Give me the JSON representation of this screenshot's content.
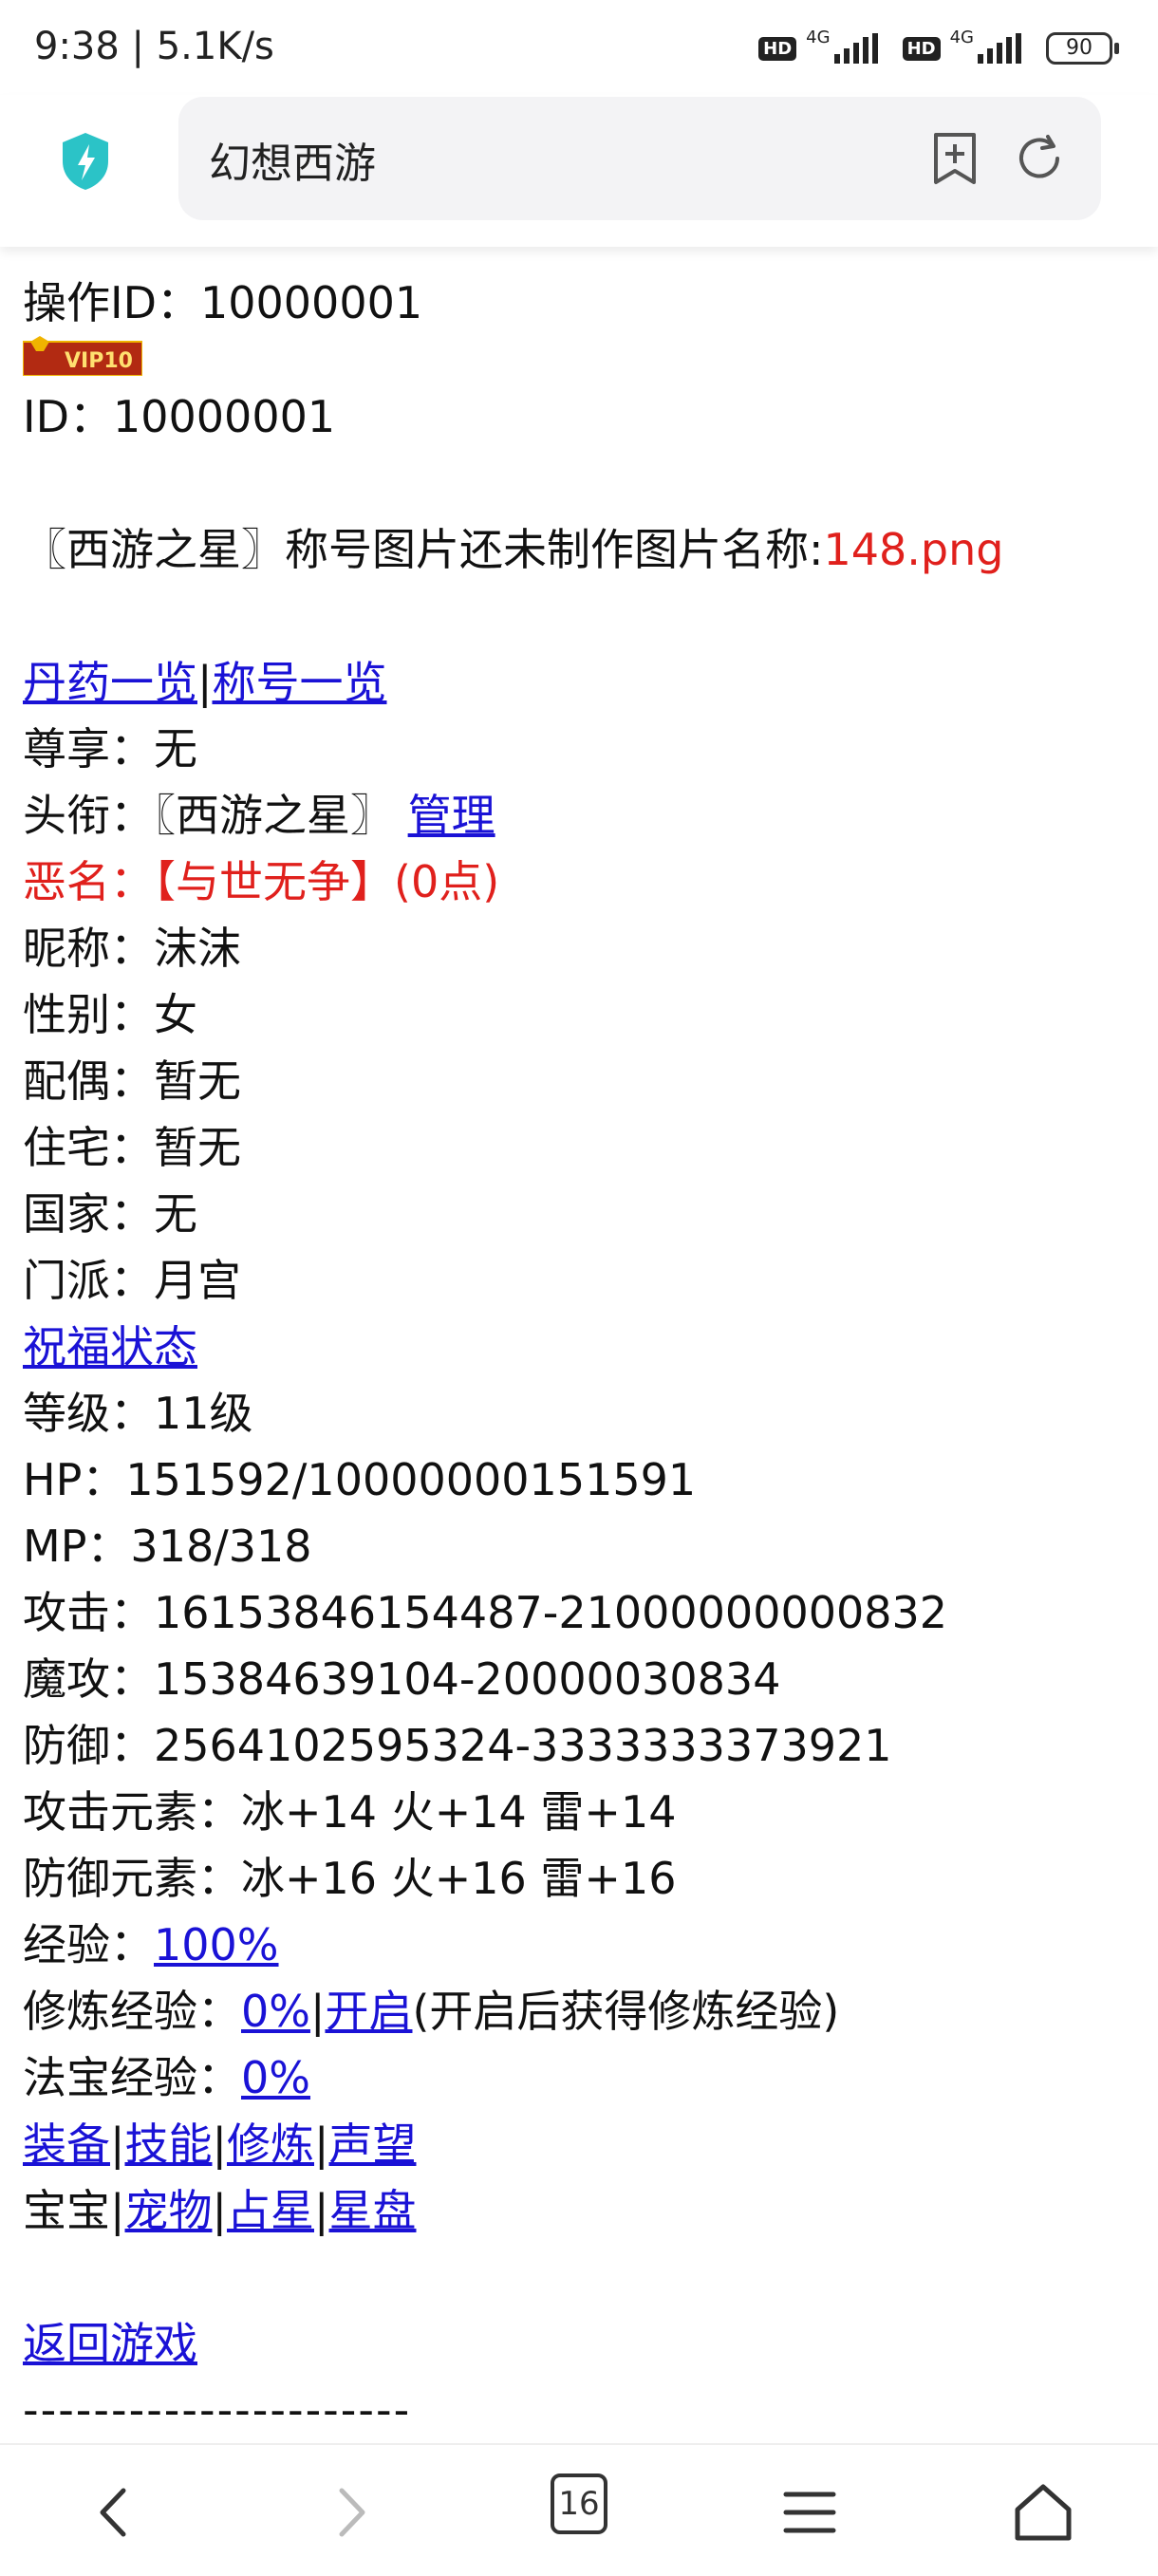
{
  "status": {
    "time": "9:38 | 5.1K/s",
    "hd1": "HD",
    "net1": "4G",
    "hd2": "HD",
    "net2": "4G",
    "battery": "90"
  },
  "browser": {
    "url_title": "幻想西游",
    "tab_count": "16"
  },
  "profile": {
    "op_id": "操作ID：10000001",
    "vip_badge": "VIP10",
    "id": "ID：10000001",
    "title_notice_prefix": "〖西游之星〗称号图片还未制作图片名称:",
    "title_notice_file": "148.png",
    "links_top": {
      "pill_list": "丹药一览",
      "sep": "|",
      "title_list": "称号一览"
    },
    "zunxiang": "尊享：无",
    "touxian_prefix": "头衔：〖西游之星〗",
    "touxian_manage": "管理",
    "infamy": "恶名：【与世无争】(0点)",
    "nickname": "昵称：沫沫",
    "gender": "性别：女",
    "spouse": "配偶：暂无",
    "home": "住宅：暂无",
    "country": "国家：无",
    "sect": "门派：月宫",
    "blessing_link": "祝福状态",
    "level": "等级：11级",
    "hp": "HP：151592/10000000151591",
    "mp": "MP：318/318",
    "attack": "攻击：16153846154487-21000000000832",
    "magic_attack": "魔攻：15384639104-20000030834",
    "defense": "防御：2564102595324-3333333373921",
    "attack_elements": "攻击元素：冰+14 火+14 雷+14",
    "defense_elements": "防御元素：冰+16 火+16 雷+16",
    "exp_label": "经验：",
    "exp_value": "100%",
    "cultivate_label": "修炼经验：",
    "cultivate_value": "0%",
    "cultivate_sep": "|",
    "cultivate_open": "开启",
    "cultivate_note": "(开启后获得修炼经验)",
    "treasure_label": "法宝经验：",
    "treasure_value": "0%",
    "nav1": [
      "装备",
      "技能",
      "修炼",
      "声望"
    ],
    "nav2_prefix": "宝宝",
    "nav2": [
      "宠物",
      "占星",
      "星盘"
    ],
    "back_link": "返回游戏",
    "divider": "----------------------"
  },
  "colors": {
    "link": "#1a12d6",
    "red": "#e0201c",
    "shield": "#2bc3c7"
  }
}
